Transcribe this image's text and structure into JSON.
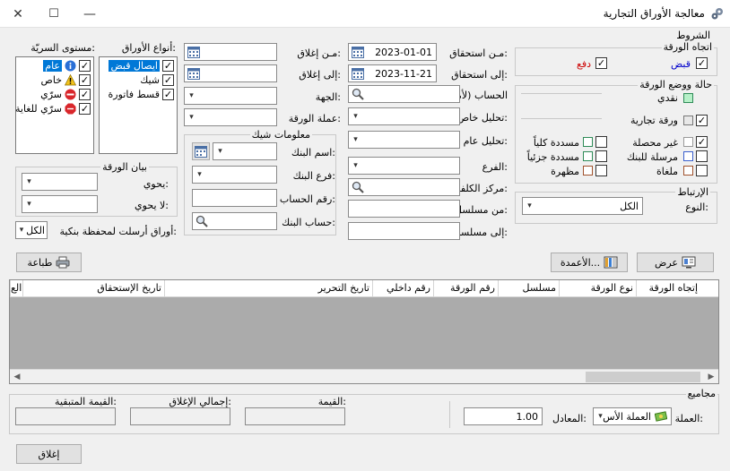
{
  "window": {
    "title": "معالجة الأوراق التجارية",
    "minimize": "—",
    "maximize": "☐",
    "close": "✕"
  },
  "conditions": {
    "title": "الشروط",
    "direction": {
      "title": "اتجاه الورقة",
      "receipt": "قبض",
      "payment": "دفع",
      "receipt_color": "#0000cc",
      "payment_color": "#cc0000"
    },
    "status": {
      "title": "حالة ووضع الورقة",
      "cash": "نقدي",
      "commercial": "ورقة تجارية",
      "uncollected": "غير محصلة",
      "fully_paid": "مسددة كلياً",
      "sent_to_bank": "مرسلة للبنك",
      "partially_paid": "مسددة جزئياً",
      "cancelled": "ملغاة",
      "endorsed": "مظهرة"
    },
    "link": {
      "title": "الإرتباط",
      "type_label": "النوع:",
      "type_value": "الكل"
    }
  },
  "filters": {
    "from_due_label": "مـن استحقاق:",
    "from_due_value": "2023-01-01",
    "to_due_label": "إلى استحقاق:",
    "to_due_value": "2023-11-21",
    "account_label": "الحساب (لأمر)",
    "special_analysis_label": "تحليل خاص:",
    "general_analysis_label": "تحليل عام:",
    "branch_label": "الفرع:",
    "cost_center_label": "مركز الكلفة:",
    "from_serial_label": "من مسلسل:",
    "to_serial_label": "إلى مسلسل:",
    "from_close_label": "مـن إغلاق:",
    "to_close_label": "إلى إغلاق:",
    "party_label": "الجهة:",
    "currency_label": "عملة الورقة:"
  },
  "check_info": {
    "title": "معلومات شيك",
    "bank_name_label": "اسم البنك:",
    "bank_branch_label": "فرع البنك:",
    "account_number_label": "رقم الحساب:",
    "bank_account_label": "حساب البنك:"
  },
  "paper_types": {
    "title": "أنواع الأوراق:",
    "items": [
      "ايصال قبض",
      "شيك",
      "قسط فاتورة"
    ]
  },
  "secrecy": {
    "title": "مستوى السريّة:",
    "items": [
      "عام",
      "خاص",
      "سرّي",
      "سرّي للغاية"
    ]
  },
  "statement": {
    "title": "بيان الورقة",
    "contains_label": "يحوي:",
    "not_contains_label": "لا يحوي:"
  },
  "bank_portfolio": {
    "label": "أوراق أرسلت لمحفظة بنكية:",
    "value": "الكل"
  },
  "buttons": {
    "show": "عرض",
    "columns": "الأعمدة...",
    "print": "طباعة",
    "close": "إغلاق"
  },
  "grid": {
    "headers": [
      "إتجاه الورقة",
      "نوع الورقة",
      "مسلسل",
      "رقم الورقة",
      "رقم داخلي",
      "تاريخ التحرير",
      "تاريخ الإستحقاق",
      "الع"
    ]
  },
  "totals": {
    "title": "مجاميع",
    "currency_label": "العملة:",
    "currency_value": "العملة الأس",
    "rate_label": "المعادل:",
    "rate_value": "1.00",
    "value_label": "القيمة:",
    "total_close_label": "إجمالي الإغلاق:",
    "remaining_label": "القيمة المتبقية:"
  },
  "colors": {
    "accent": "#0078d7",
    "grid_body": "#ababab",
    "square_cash": "#2e8b57",
    "square_uncollected": "#999999",
    "square_fully_paid": "#2e8b57",
    "square_sent": "#3a5fcd",
    "square_partial": "#2e8b57",
    "square_cancelled": "#a0522d",
    "square_endorsed": "#a0522d"
  }
}
